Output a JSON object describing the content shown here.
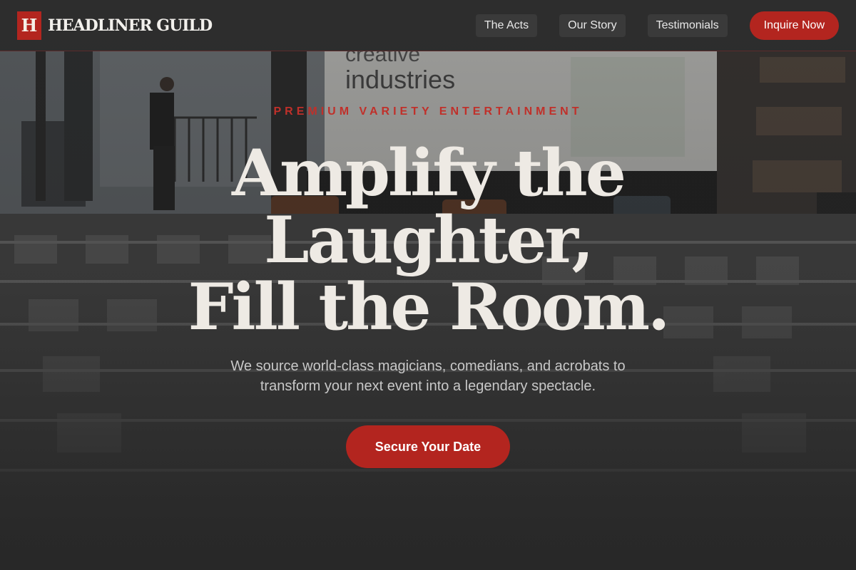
{
  "brand": {
    "mark": "H",
    "name": "HEADLINER GUILD"
  },
  "nav": {
    "links": [
      "The Acts",
      "Our Story",
      "Testimonials"
    ],
    "cta_label": "Inquire Now"
  },
  "hero": {
    "eyebrow": "PREMIUM VARIETY ENTERTAINMENT",
    "headline": [
      "Amplify the",
      "Laughter,",
      "Fill the Room."
    ],
    "subhead": [
      "We source world-class magicians, comedians, and acrobats to",
      "transform your next event into a legendary spectacle."
    ],
    "cta_label": "Secure Your Date",
    "background_text": [
      "creative",
      "industries"
    ]
  },
  "colors": {
    "accent": "#b3251f",
    "header_bg": "#2c2c2c",
    "text_light": "#eeeae4"
  }
}
